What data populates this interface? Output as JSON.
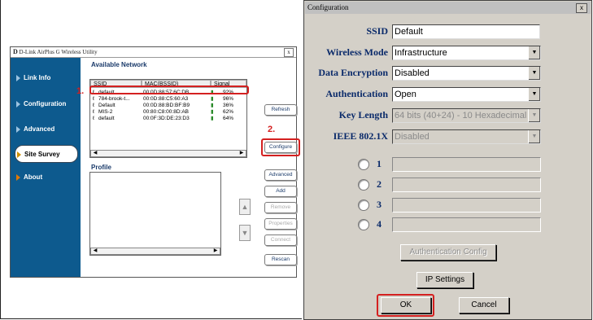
{
  "utility": {
    "logo": "D",
    "title": "D-Link AirPlus G Wireless Utility",
    "close": "x",
    "nav": [
      {
        "label": "Link Info"
      },
      {
        "label": "Configuration"
      },
      {
        "label": "Advanced"
      },
      {
        "label": "Site Survey"
      },
      {
        "label": "About"
      }
    ],
    "available_header": "Available Network",
    "columns": [
      "SSID",
      "MAC(BSSID)",
      "Signal"
    ],
    "networks": [
      {
        "ssid": "default",
        "mac": "00:0D:88:57:6C:DB",
        "signal": "92%"
      },
      {
        "ssid": "784-brook-t...",
        "mac": "00:0D:88:C5:60:A3",
        "signal": "96%"
      },
      {
        "ssid": "Default",
        "mac": "00:0D:88:BD:BF:B9",
        "signal": "36%"
      },
      {
        "ssid": "MIS-2",
        "mac": "00:80:C8:00:8D:AB",
        "signal": "62%"
      },
      {
        "ssid": "default",
        "mac": "00:0F:3D:DE:23:D3",
        "signal": "64%"
      }
    ],
    "profile_header": "Profile",
    "buttons": {
      "refresh": "Refresh",
      "configure": "Configure",
      "advanced": "Advanced",
      "add": "Add",
      "remove": "Remove",
      "properties": "Properties",
      "connect": "Connect",
      "rescan": "Rescan"
    },
    "steps": {
      "one": "1.",
      "two": "2."
    }
  },
  "config_dialog": {
    "title": "Configuration",
    "close": "x",
    "fields": {
      "ssid": {
        "label": "SSID",
        "value": "Default"
      },
      "wireless_mode": {
        "label": "Wireless Mode",
        "value": "Infrastructure"
      },
      "data_encryption": {
        "label": "Data Encryption",
        "value": "Disabled"
      },
      "authentication": {
        "label": "Authentication",
        "value": "Open"
      },
      "key_length": {
        "label": "Key Length",
        "value": "64 bits (40+24) - 10 Hexadecimal"
      },
      "ieee": {
        "label": "IEEE 802.1X",
        "value": "Disabled"
      }
    },
    "keys": [
      "1",
      "2",
      "3",
      "4"
    ],
    "buttons": {
      "auth_config": "Authentication Config",
      "ip_settings": "IP Settings",
      "ok": "OK",
      "cancel": "Cancel"
    }
  },
  "colors": {
    "sidebar": "#0d5a8e",
    "highlight": "#d42020",
    "label_blue": "#0a2a6a",
    "dialog_bg": "#d4d0c8"
  }
}
